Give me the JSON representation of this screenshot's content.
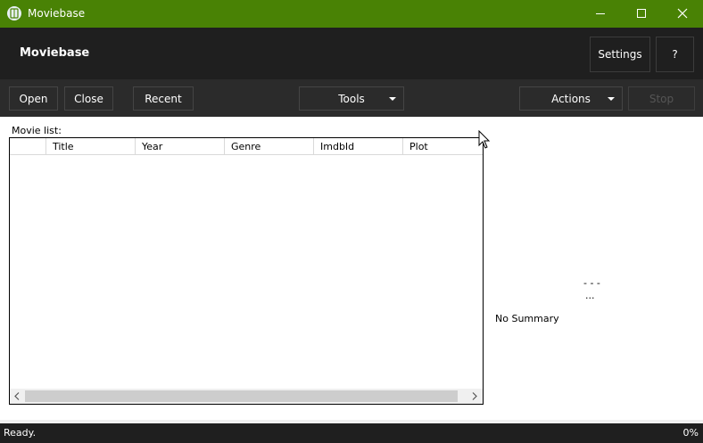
{
  "window": {
    "title": "Moviebase",
    "icon": "app-logo-icon",
    "controls": [
      "minimize-icon",
      "maximize-icon",
      "close-icon"
    ]
  },
  "header": {
    "title": "Moviebase",
    "settings_label": "Settings",
    "help_label": "?"
  },
  "toolbar": {
    "open_label": "Open",
    "close_label": "Close",
    "recent_label": "Recent",
    "tools_label": "Tools",
    "actions_label": "Actions",
    "stop_label": "Stop"
  },
  "movie_list": {
    "label": "Movie list:",
    "columns": [
      "",
      "Title",
      "Year",
      "Genre",
      "ImdbId",
      "Plot"
    ],
    "rows": []
  },
  "preview": {
    "dash": "- - -",
    "dots": "...",
    "summary": "No Summary"
  },
  "status": {
    "text": "Ready.",
    "progress": "0%"
  },
  "colors": {
    "titlebar": "#498205",
    "header": "#1f1f1f",
    "toolbar": "#2b2b2b"
  }
}
